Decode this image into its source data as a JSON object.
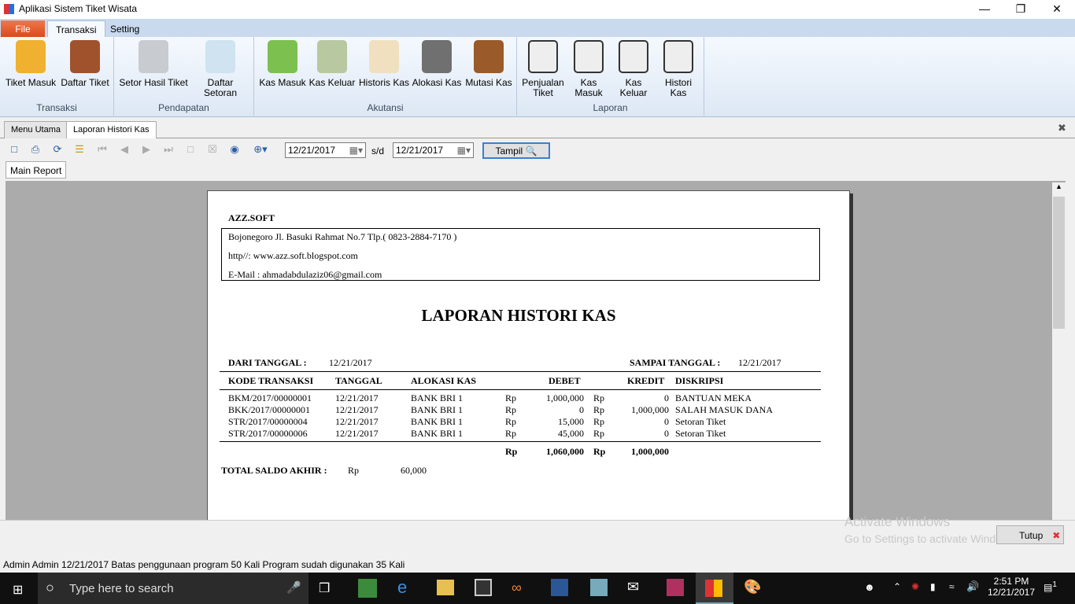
{
  "window": {
    "title": "Aplikasi Sistem Tiket Wisata"
  },
  "ribbon": {
    "tabs": [
      "File",
      "Transaksi",
      "Setting"
    ],
    "groups": [
      {
        "label": "Transaksi",
        "buttons": [
          "Tiket Masuk",
          "Daftar Tiket"
        ]
      },
      {
        "label": "Pendapatan",
        "buttons": [
          "Setor Hasil Tiket",
          "Daftar Setoran"
        ]
      },
      {
        "label": "Akutansi",
        "buttons": [
          "Kas Masuk",
          "Kas Keluar",
          "Historis Kas",
          "Alokasi Kas",
          "Mutasi Kas"
        ]
      },
      {
        "label": "Laporan",
        "buttons": [
          "Penjualan Tiket",
          "Kas Masuk",
          "Kas Keluar",
          "Histori Kas"
        ]
      }
    ]
  },
  "doc_tabs": [
    "Menu Utama",
    "Laporan Histori Kas"
  ],
  "toolbar": {
    "date_from": "12/21/2017",
    "sep": "s/d",
    "date_to": "12/21/2017",
    "tampil": "Tampil"
  },
  "report_tab": "Main Report",
  "report": {
    "company": "AZZ.SOFT",
    "address": "Bojonegoro Jl. Basuki Rahmat No.7  Tlp.( 0823-2884-7170 )",
    "web": "http//: www.azz.soft.blogspot.com",
    "email": "E-Mail : ahmadabdulaziz06@gmail.com",
    "title": "LAPORAN HISTORI KAS",
    "from_label": "DARI TANGGAL :",
    "from": "12/21/2017",
    "to_label": "SAMPAI TANGGAL :",
    "to": "12/21/2017",
    "headers": [
      "KODE TRANSAKSI",
      "TANGGAL",
      "ALOKASI KAS",
      "DEBET",
      "KREDIT",
      "DISKRIPSI"
    ],
    "rows": [
      {
        "kode": "BKM/2017/00000001",
        "tanggal": "12/21/2017",
        "alokasi": "BANK BRI 1",
        "rp1": "Rp",
        "debet": "1,000,000",
        "rp2": "Rp",
        "kredit": "0",
        "desk": "BANTUAN MEKA"
      },
      {
        "kode": "BKK/2017/00000001",
        "tanggal": "12/21/2017",
        "alokasi": "BANK BRI 1",
        "rp1": "Rp",
        "debet": "0",
        "rp2": "Rp",
        "kredit": "1,000,000",
        "desk": "SALAH MASUK DANA"
      },
      {
        "kode": "STR/2017/00000004",
        "tanggal": "12/21/2017",
        "alokasi": "BANK BRI 1",
        "rp1": "Rp",
        "debet": "15,000",
        "rp2": "Rp",
        "kredit": "0",
        "desk": "Setoran Tiket"
      },
      {
        "kode": "STR/2017/00000006",
        "tanggal": "12/21/2017",
        "alokasi": "BANK BRI 1",
        "rp1": "Rp",
        "debet": "45,000",
        "rp2": "Rp",
        "kredit": "0",
        "desk": "Setoran Tiket"
      }
    ],
    "total": {
      "rp1": "Rp",
      "debet": "1,060,000",
      "rp2": "Rp",
      "kredit": "1,000,000"
    },
    "saldo_label": "TOTAL SALDO AKHIR :",
    "saldo_rp": "Rp",
    "saldo": "60,000"
  },
  "watermark": {
    "line1": "Activate Windows",
    "line2": "Go to Settings to activate Windows."
  },
  "tutup": "Tutup",
  "status": "Admin  Admin  12/21/2017  Batas penggunaan program  50  Kali  Program sudah digunakan  35  Kali",
  "taskbar": {
    "search": "Type here to search",
    "time": "2:51 PM",
    "date": "12/21/2017",
    "notif": "1"
  }
}
